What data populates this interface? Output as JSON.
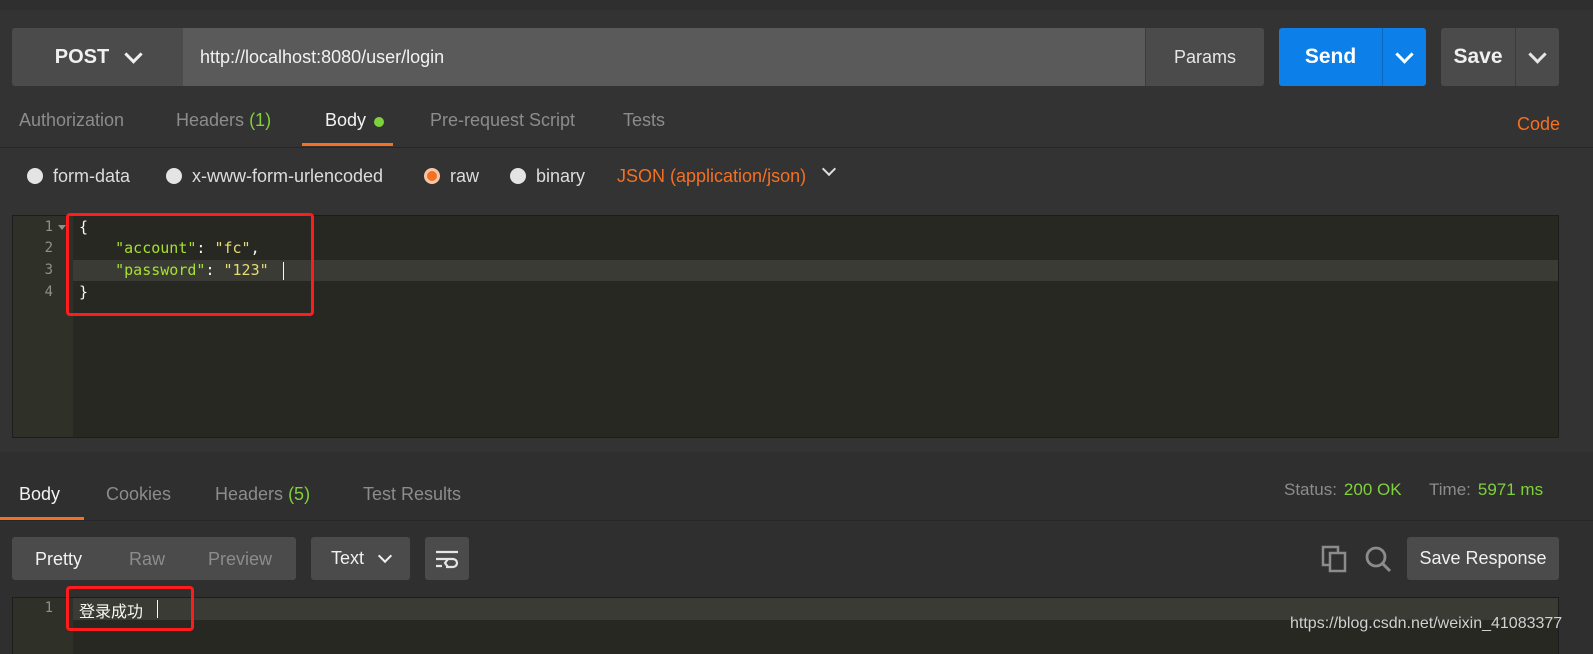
{
  "request": {
    "method": "POST",
    "url": "http://localhost:8080/user/login",
    "params_label": "Params",
    "send_label": "Send",
    "save_label": "Save"
  },
  "request_tabs": {
    "authorization": "Authorization",
    "headers": "Headers",
    "headers_count": "(1)",
    "body": "Body",
    "pre_request": "Pre-request Script",
    "tests": "Tests",
    "code_link": "Code"
  },
  "body_types": {
    "form_data": "form-data",
    "urlencoded": "x-www-form-urlencoded",
    "raw": "raw",
    "binary": "binary",
    "selected": "raw",
    "content_type": "JSON (application/json)"
  },
  "request_body": {
    "line_numbers": [
      "1",
      "2",
      "3",
      "4"
    ],
    "open_brace": "{",
    "close_brace": "}",
    "indent": "    ",
    "key1": "\"account\"",
    "value1": "\"fc\"",
    "key2": "\"password\"",
    "value2": "\"123\"",
    "colon": ": ",
    "comma": ","
  },
  "response_tabs": {
    "body": "Body",
    "cookies": "Cookies",
    "headers": "Headers",
    "headers_count": "(5)",
    "test_results": "Test Results"
  },
  "response_meta": {
    "status_label": "Status:",
    "status_value": "200 OK",
    "time_label": "Time:",
    "time_value": "5971 ms"
  },
  "response_toolbar": {
    "pretty": "Pretty",
    "raw": "Raw",
    "preview": "Preview",
    "format": "Text",
    "save_response": "Save Response"
  },
  "response_body": {
    "line_number": "1",
    "text": "登录成功"
  },
  "watermark": "https://blog.csdn.net/weixin_41083377",
  "colors": {
    "accent": "#f47023",
    "send": "#0d7fe8",
    "success": "#7fd13b",
    "highlight": "#ff1c1c"
  },
  "icons": [
    "chevron-down-icon",
    "wrap-lines-icon",
    "copy-icon",
    "search-icon"
  ]
}
